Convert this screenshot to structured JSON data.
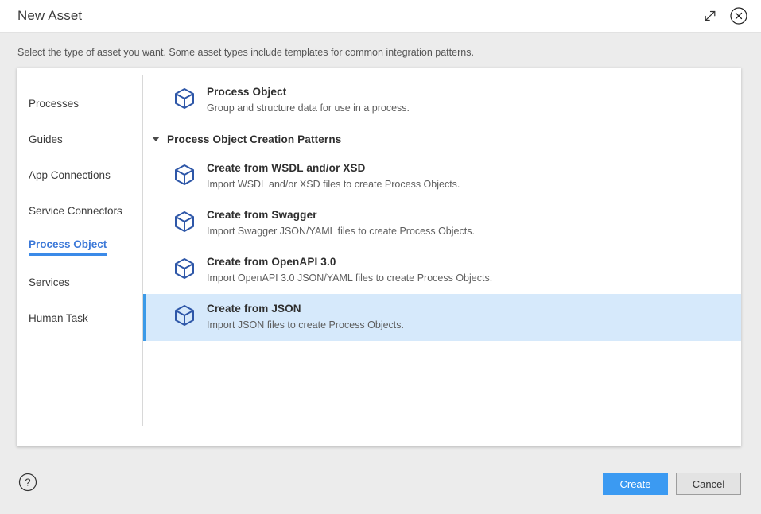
{
  "window": {
    "title": "New Asset",
    "expand_icon": "expand-diagonal-icon",
    "close_icon": "close-circle-icon"
  },
  "subtitle": "Select the type of asset you want. Some asset types include templates for common integration patterns.",
  "sidebar": {
    "items": [
      {
        "label": "Processes",
        "active": false
      },
      {
        "label": "Guides",
        "active": false
      },
      {
        "label": "App Connections",
        "active": false
      },
      {
        "label": "Service Connectors",
        "active": false
      },
      {
        "label": "Process Object",
        "active": true
      },
      {
        "label": "Services",
        "active": false
      },
      {
        "label": "Human Task",
        "active": false
      }
    ]
  },
  "main": {
    "primary_asset": {
      "title": "Process Object",
      "description": "Group and structure data for use in a process.",
      "icon": "cube-icon"
    },
    "section": {
      "title": "Process Object Creation Patterns",
      "expanded": true,
      "disclosure_icon": "triangle-down-icon"
    },
    "patterns": [
      {
        "title": "Create from WSDL and/or XSD",
        "description": "Import WSDL and/or XSD files to create Process Objects.",
        "icon": "cube-icon",
        "selected": false
      },
      {
        "title": "Create from Swagger",
        "description": "Import Swagger JSON/YAML files to create Process Objects.",
        "icon": "cube-icon",
        "selected": false
      },
      {
        "title": "Create from OpenAPI 3.0",
        "description": "Import OpenAPI 3.0 JSON/YAML files to create Process Objects.",
        "icon": "cube-icon",
        "selected": false
      },
      {
        "title": "Create from JSON",
        "description": "Import JSON files to create Process Objects.",
        "icon": "cube-icon",
        "selected": true
      }
    ]
  },
  "footer": {
    "help_icon": "help-circle-icon",
    "create_label": "Create",
    "cancel_label": "Cancel"
  },
  "colors": {
    "accent_blue": "#3b9af2",
    "selected_row_bg": "#d6e9fb",
    "selected_row_bar": "#3b9ae8",
    "sidebar_active_text": "#3b78d8",
    "cube_icon": "#2e57a8",
    "page_bg": "#ececec"
  }
}
